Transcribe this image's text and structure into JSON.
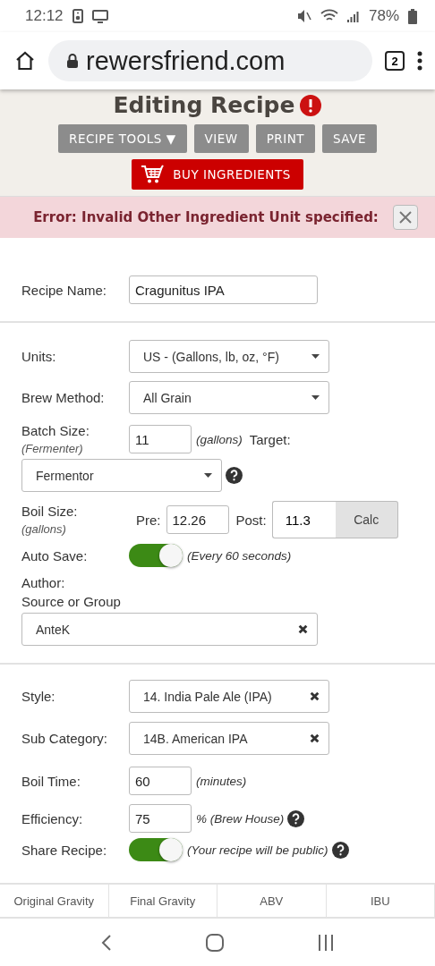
{
  "status_bar": {
    "time": "12:12",
    "battery": "78%"
  },
  "browser": {
    "url": "rewersfriend.com",
    "tab_count": "2"
  },
  "header": {
    "title": "Editing Recipe",
    "buttons": [
      {
        "label": "RECIPE TOOLS ▼"
      },
      {
        "label": "VIEW"
      },
      {
        "label": "PRINT"
      },
      {
        "label": "SAVE"
      }
    ],
    "buy_button": "BUY INGREDIENTS"
  },
  "error": {
    "message": "Error: Invalid Other Ingredient Unit specified:"
  },
  "recipe_name": {
    "label": "Recipe Name:",
    "value": "Cragunitus IPA"
  },
  "units": {
    "label": "Units:",
    "value": "US - (Gallons, lb, oz, °F)"
  },
  "brew_method": {
    "label": "Brew Method:",
    "value": "All Grain"
  },
  "batch_size": {
    "label": "Batch Size:",
    "sublabel": "(Fermenter)",
    "value": "11",
    "unit": "(gallons)",
    "target_label": "Target:",
    "target_value": "Fermentor"
  },
  "boil_size": {
    "label": "Boil Size:",
    "sublabel": "(gallons)",
    "pre_label": "Pre:",
    "pre_value": "12.26",
    "post_label": "Post:",
    "post_value": "11.3",
    "calc_button": "Calc"
  },
  "auto_save": {
    "label": "Auto Save:",
    "on": true,
    "note": "(Every 60 seconds)"
  },
  "author": {
    "label": "Author:"
  },
  "source": {
    "label": "Source or Group",
    "value": "AnteK"
  },
  "style": {
    "label": "Style:",
    "value": "14. India Pale Ale (IPA)"
  },
  "sub_category": {
    "label": "Sub Category:",
    "value": "14B. American IPA"
  },
  "boil_time": {
    "label": "Boil Time:",
    "value": "60",
    "unit": "(minutes)"
  },
  "efficiency": {
    "label": "Efficiency:",
    "value": "75",
    "unit": "% (Brew House)"
  },
  "share_recipe": {
    "label": "Share Recipe:",
    "on": true,
    "note": "(Your recipe will be public)"
  },
  "stats_tabs": [
    {
      "label": "Original Gravity"
    },
    {
      "label": "Final Gravity"
    },
    {
      "label": "ABV"
    },
    {
      "label": "IBU"
    }
  ]
}
